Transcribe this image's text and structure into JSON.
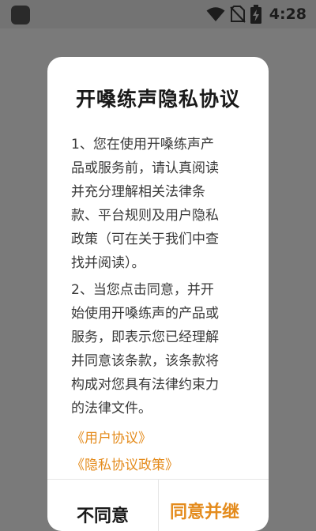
{
  "status_bar": {
    "time": "4:28",
    "icons": [
      "app-icon",
      "wifi-icon",
      "no-sim-icon",
      "battery-charging-icon"
    ]
  },
  "dialog": {
    "title": "开嗓练声隐私协议",
    "paragraph1": [
      "1、您在使用开嗓练声产",
      "品或服务前，请认真阅读",
      "并充分理解相关法律条",
      "款、平台规则及用户隐私",
      "政策（可在关于我们中查",
      "找并阅读）。"
    ],
    "paragraph2": [
      "2、当您点击同意，并开",
      "始使用开嗓练声的产品或",
      "服务，即表示您已经理解",
      "并同意该条款，该条款将",
      "构成对您具有法律约束力",
      "的法律文件。"
    ],
    "links": {
      "user_agreement": "《用户协议》",
      "privacy_policy": "《隐私协议政策》"
    },
    "buttons": {
      "disagree": "不同意",
      "agree": "同意并继"
    }
  },
  "colors": {
    "accent": "#e48b1c",
    "overlay": "#7a7a7a",
    "dialog_bg": "#ffffff"
  }
}
